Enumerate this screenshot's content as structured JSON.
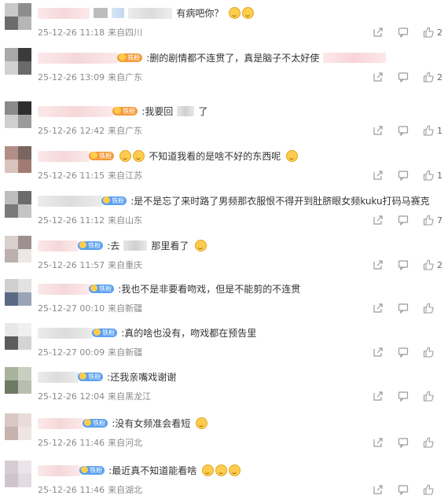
{
  "colors": {
    "text": "#333333",
    "meta": "#8a8a8a",
    "icon": "#9a9a9a",
    "badge_orange": "#f39b3a",
    "badge_blue": "#5aa0f0"
  },
  "comments": [
    {
      "prefix": "",
      "badge": "",
      "badge_color": "",
      "text": "有病吧你？",
      "date": "25-12-26 11:18",
      "source": "来自四川",
      "likes": "2"
    },
    {
      "prefix": "",
      "badge": "铁粉",
      "badge_color": "orange",
      "text": ":删的剧情都不连贯了，真是脑子不太好使",
      "date": "25-12-26 13:09",
      "source": "来自广东",
      "likes": "2"
    },
    {
      "prefix": "",
      "badge": "铁粉",
      "badge_color": "orange",
      "text": ":我要回",
      "text_after": "了",
      "date": "25-12-26 12:42",
      "source": "来自广东",
      "likes": "1"
    },
    {
      "prefix": "",
      "badge": "铁粉",
      "badge_color": "orange",
      "text": "不知道我看的是啥不好的东西呢",
      "date": "25-12-26 11:15",
      "source": "来自江苏",
      "likes": "1"
    },
    {
      "prefix": "",
      "badge": "铁粉",
      "badge_color": "blue",
      "text": ":是不是忘了来时路了男频那衣服恨不得开到肚脐眼女频kuku打码马赛克",
      "date": "25-12-26 11:12",
      "source": "来自山东",
      "likes": "7"
    },
    {
      "prefix": "",
      "badge": "铁粉",
      "badge_color": "blue",
      "text": ":去",
      "text_after": "那里看了",
      "date": "25-12-26 11:57",
      "source": "来自重庆",
      "likes": "2"
    },
    {
      "prefix": "",
      "badge": "铁粉",
      "badge_color": "blue",
      "text": ":我也不是非要看吻戏，但是不能剪的不连贯",
      "date": "25-12-27 00:10",
      "source": "来自新疆",
      "likes": ""
    },
    {
      "prefix": "",
      "badge": "铁粉",
      "badge_color": "blue",
      "text": ":真的啥也没有，吻戏都在预告里",
      "date": "25-12-27 00:09",
      "source": "来自新疆",
      "likes": ""
    },
    {
      "prefix": "",
      "badge": "铁粉",
      "badge_color": "blue",
      "text": ":还我亲嘴戏谢谢",
      "date": "25-12-26 12:04",
      "source": "来自黑龙江",
      "likes": ""
    },
    {
      "prefix": "",
      "badge": "铁粉",
      "badge_color": "blue",
      "text": ":没有女频准会看短",
      "date": "25-12-26 11:46",
      "source": "来自河北",
      "likes": ""
    },
    {
      "prefix": "",
      "badge": "铁粉",
      "badge_color": "blue",
      "text": ":最近真不知道能看啥",
      "date": "25-12-26 11:46",
      "source": "来自湖北",
      "likes": ""
    }
  ],
  "icons": {
    "share": "share-icon",
    "reply": "comment-icon",
    "like": "thumbs-up-icon"
  }
}
